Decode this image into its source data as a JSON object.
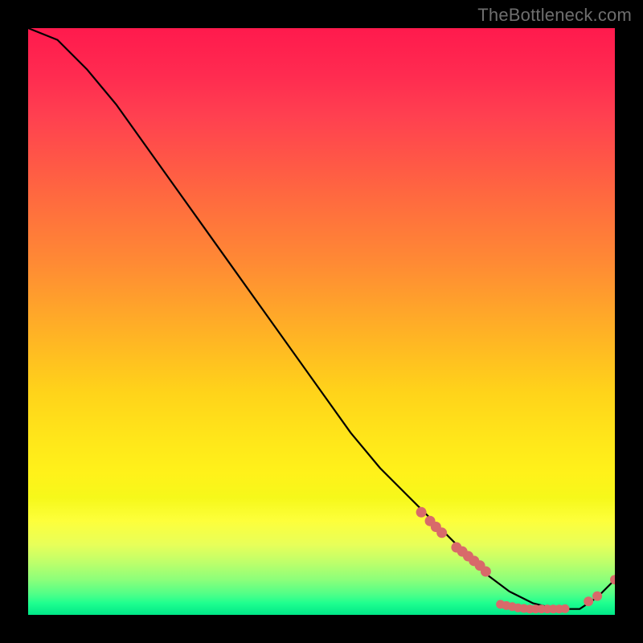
{
  "watermark": "TheBottleneck.com",
  "chart_data": {
    "type": "line",
    "title": "",
    "xlabel": "",
    "ylabel": "",
    "xlim": [
      0,
      100
    ],
    "ylim": [
      0,
      100
    ],
    "grid": false,
    "series": [
      {
        "name": "bottleneck-curve",
        "color": "#000000",
        "x": [
          0,
          5,
          10,
          15,
          20,
          25,
          30,
          35,
          40,
          45,
          50,
          55,
          60,
          65,
          70,
          74,
          78,
          82,
          86,
          90,
          94,
          97,
          100
        ],
        "y": [
          100,
          98,
          93,
          87,
          80,
          73,
          66,
          59,
          52,
          45,
          38,
          31,
          25,
          20,
          15,
          11,
          7,
          4,
          2,
          1,
          1,
          3,
          6
        ]
      }
    ],
    "marker_groups": [
      {
        "name": "slope-markers",
        "color": "#d86a6a",
        "radius": 6.5,
        "points": [
          {
            "x": 67,
            "y": 17.5
          },
          {
            "x": 68.5,
            "y": 16
          },
          {
            "x": 69.5,
            "y": 15
          },
          {
            "x": 70.5,
            "y": 14
          },
          {
            "x": 73,
            "y": 11.5
          },
          {
            "x": 74,
            "y": 10.8
          },
          {
            "x": 75,
            "y": 10
          },
          {
            "x": 76,
            "y": 9.2
          },
          {
            "x": 77,
            "y": 8.4
          },
          {
            "x": 78,
            "y": 7.4
          }
        ]
      },
      {
        "name": "bottom-markers",
        "color": "#d86a6a",
        "radius": 5.5,
        "points": [
          {
            "x": 80.5,
            "y": 1.8
          },
          {
            "x": 81.5,
            "y": 1.6
          },
          {
            "x": 82.5,
            "y": 1.4
          },
          {
            "x": 83.5,
            "y": 1.2
          },
          {
            "x": 84.5,
            "y": 1.1
          },
          {
            "x": 85.5,
            "y": 1.0
          },
          {
            "x": 86.5,
            "y": 1.0
          },
          {
            "x": 87.5,
            "y": 1.0
          },
          {
            "x": 88.5,
            "y": 1.0
          },
          {
            "x": 89.5,
            "y": 1.0
          },
          {
            "x": 90.5,
            "y": 1.0
          },
          {
            "x": 91.5,
            "y": 1.05
          }
        ]
      },
      {
        "name": "upturn-markers",
        "color": "#d86a6a",
        "radius": 6,
        "points": [
          {
            "x": 95.5,
            "y": 2.3
          },
          {
            "x": 97,
            "y": 3.2
          },
          {
            "x": 100,
            "y": 6.0
          }
        ]
      }
    ]
  }
}
